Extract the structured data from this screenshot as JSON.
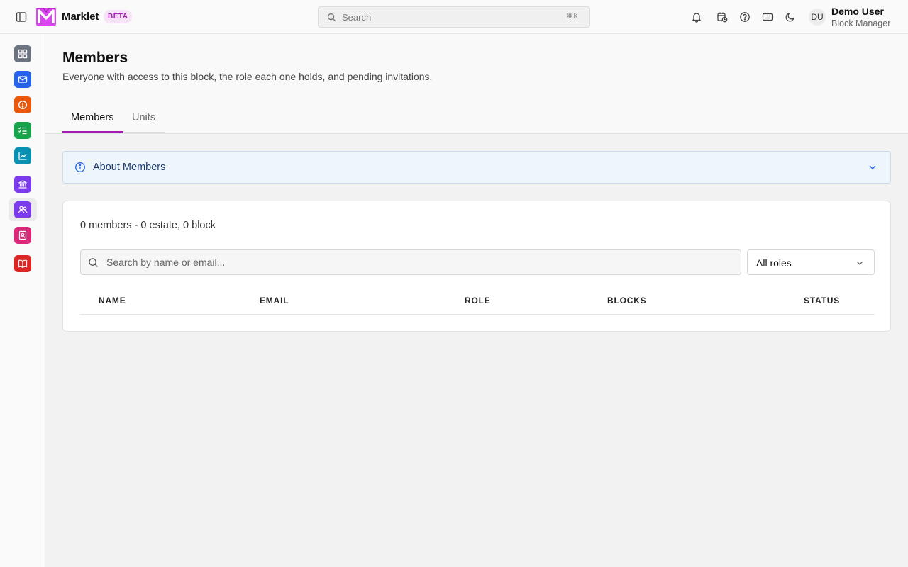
{
  "app": {
    "name": "Marklet",
    "badge": "BETA"
  },
  "topbar": {
    "search_placeholder": "Search",
    "search_shortcut": "⌘K",
    "icons": [
      "bell-icon",
      "calendar-clock-icon",
      "help-circle-icon",
      "keyboard-icon",
      "moon-icon"
    ]
  },
  "user": {
    "initials": "DU",
    "name": "Demo User",
    "role": "Block Manager"
  },
  "nav": {
    "items": [
      {
        "name": "dashboard",
        "color": "#6b7280"
      },
      {
        "name": "mail",
        "color": "#2563eb"
      },
      {
        "name": "alert",
        "color": "#ea580c"
      },
      {
        "name": "tasks",
        "color": "#16a34a"
      },
      {
        "name": "analytics",
        "color": "#0891b2"
      },
      {
        "name": "bank",
        "color": "#7c3aed"
      },
      {
        "name": "members",
        "color": "#7c3aed"
      },
      {
        "name": "contacts",
        "color": "#db2777"
      },
      {
        "name": "book",
        "color": "#dc2626"
      }
    ],
    "active": "members"
  },
  "page": {
    "title": "Members",
    "subtitle": "Everyone with access to this block, the role each one holds, and pending invitations.",
    "tabs": [
      {
        "label": "Members",
        "active": true
      },
      {
        "label": "Units",
        "active": false
      }
    ]
  },
  "about": {
    "label": "About Members"
  },
  "members": {
    "summary": "0 members - 0 estate, 0 block",
    "search_placeholder": "Search by name or email...",
    "role_filter": "All roles",
    "columns": [
      "NAME",
      "EMAIL",
      "ROLE",
      "BLOCKS",
      "STATUS"
    ],
    "rows": []
  },
  "colors": {
    "accent": "#a21caf",
    "info_bg": "#eef5fb",
    "info_text": "#1f3d6b"
  }
}
